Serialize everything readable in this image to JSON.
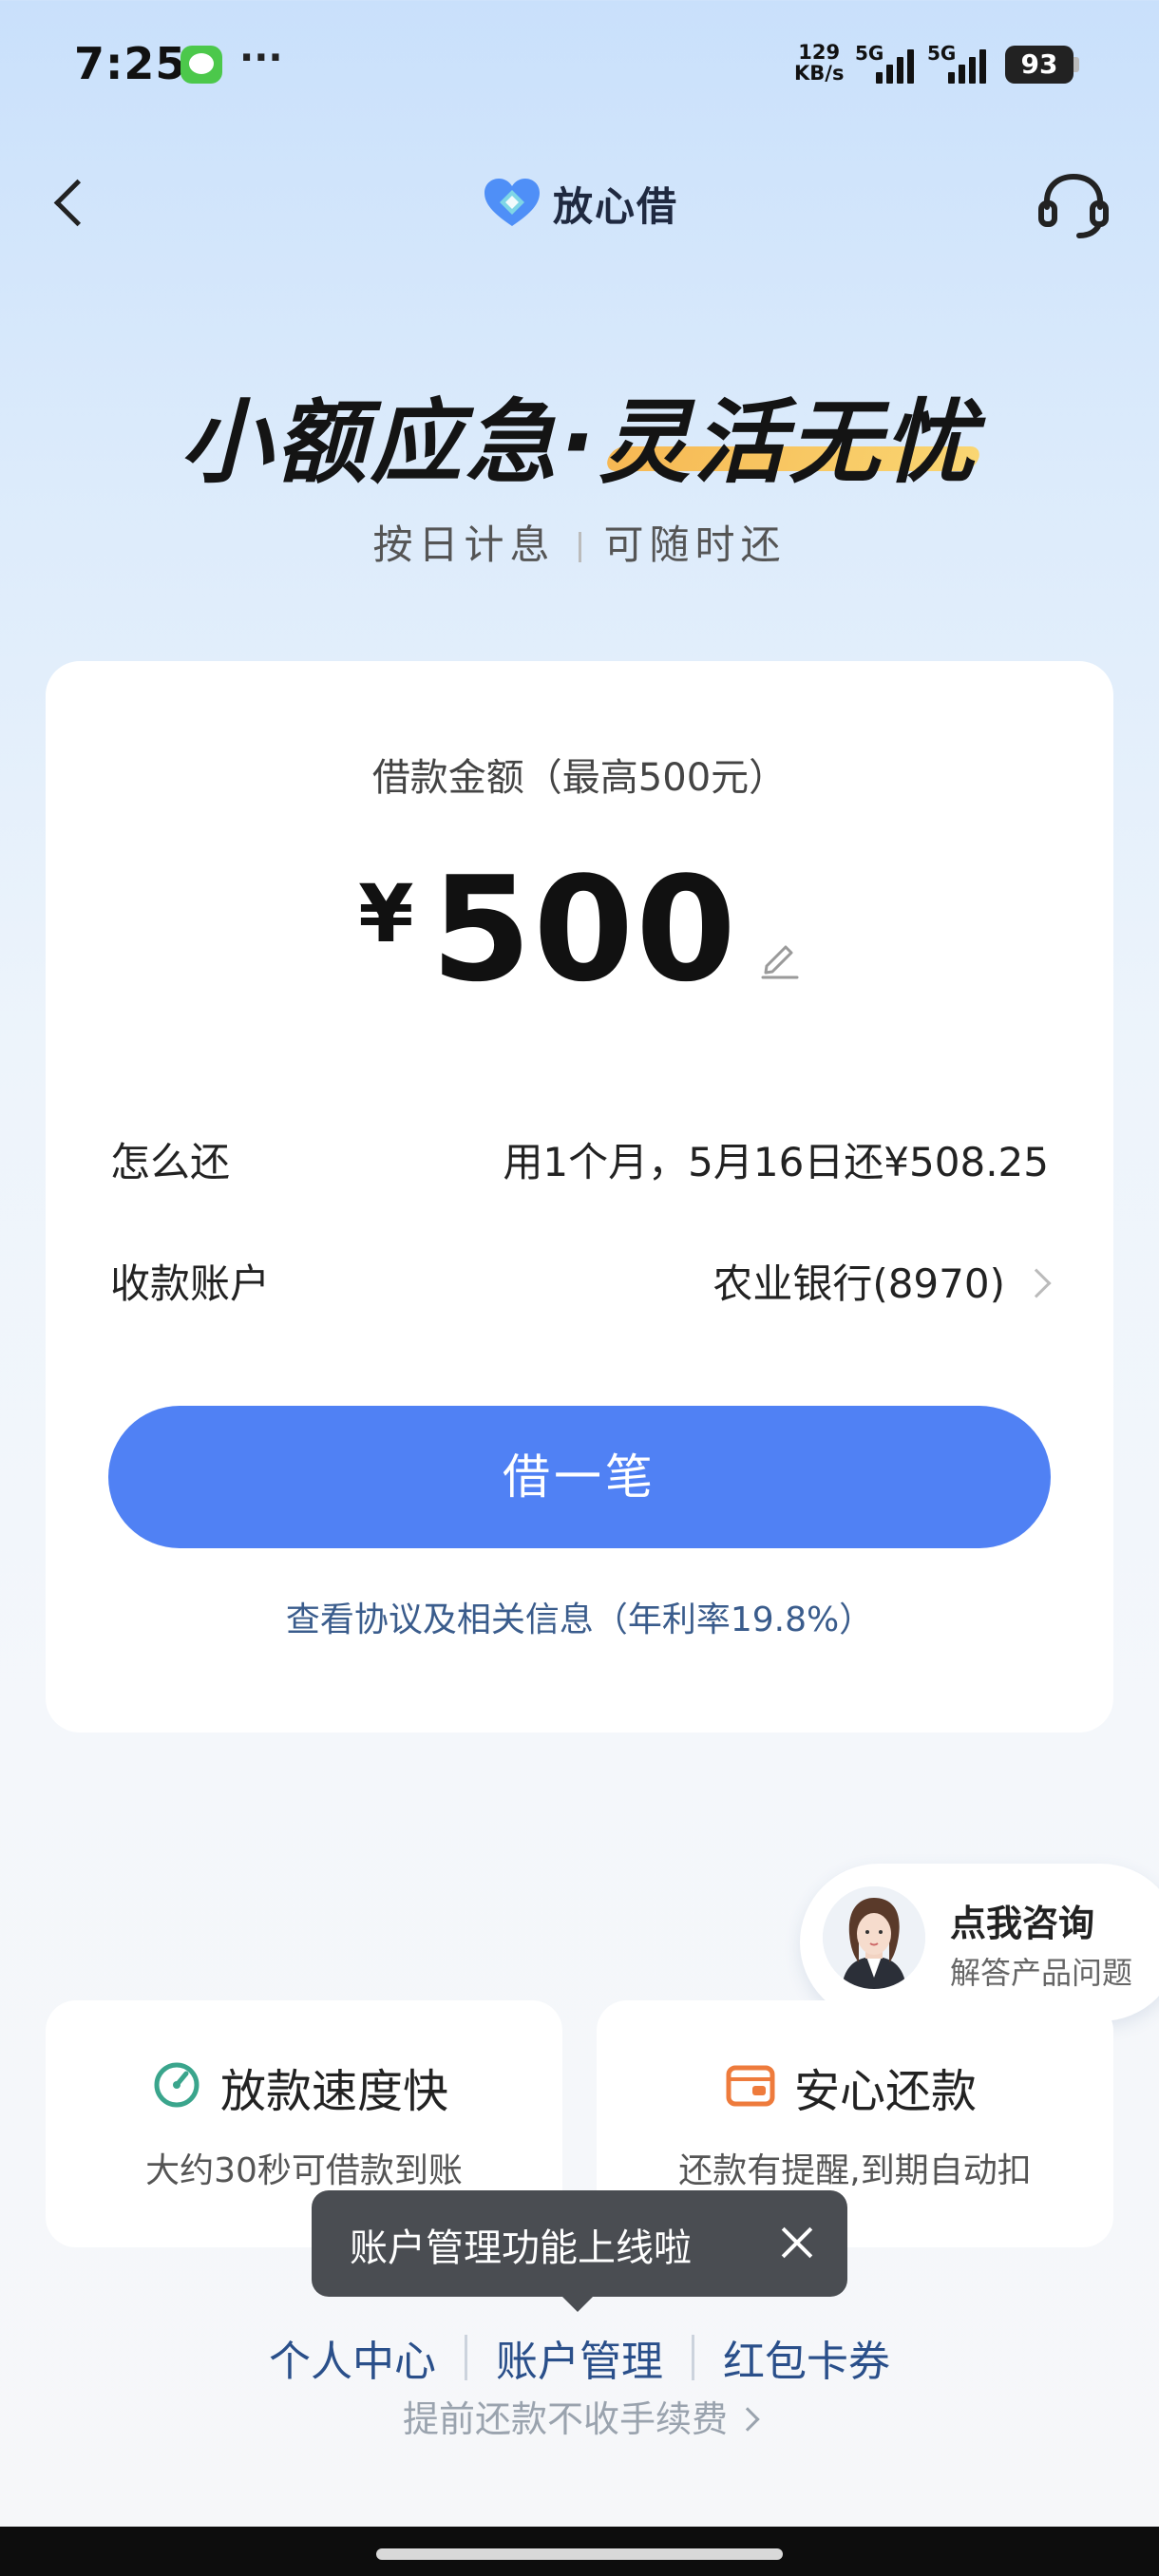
{
  "status_bar": {
    "time": "7:25",
    "dots": "···",
    "net_speed_value": "129",
    "net_speed_unit": "KB/s",
    "sim1": "5G",
    "sim2": "5G",
    "battery": "93"
  },
  "header": {
    "brand_name": "放心借"
  },
  "hero": {
    "title": "小额应急·灵活无忧",
    "subtitle_left": "按日计息",
    "subtitle_right": "可随时还"
  },
  "loan_card": {
    "amount_label": "借款金额（最高500元）",
    "currency_symbol": "¥",
    "amount": "500",
    "repay_label": "怎么还",
    "repay_value": "用1个月，5月16日还¥508.25",
    "account_label": "收款账户",
    "account_value": "农业银行(8970)",
    "borrow_button": "借一笔",
    "agreement_link": "查看协议及相关信息（年利率19.8%）"
  },
  "consult": {
    "title": "点我咨询",
    "subtitle": "解答产品问题"
  },
  "features": [
    {
      "icon": "speedometer-icon",
      "title": "放款速度快",
      "desc": "大约30秒可借款到账",
      "color": "#3aa58c"
    },
    {
      "icon": "wallet-icon",
      "title": "安心还款",
      "desc": "还款有提醒,到期自动扣",
      "color": "#ee7b3c"
    }
  ],
  "toast": {
    "text": "账户管理功能上线啦"
  },
  "bottom_links": {
    "personal_center": "个人中心",
    "account_management": "账户管理",
    "coupons": "红包卡券",
    "note": "提前还款不收手续费"
  },
  "colors": {
    "primary_button": "#5081f4",
    "link": "#2a4f8a",
    "hero_underline": "#f8b54a"
  }
}
